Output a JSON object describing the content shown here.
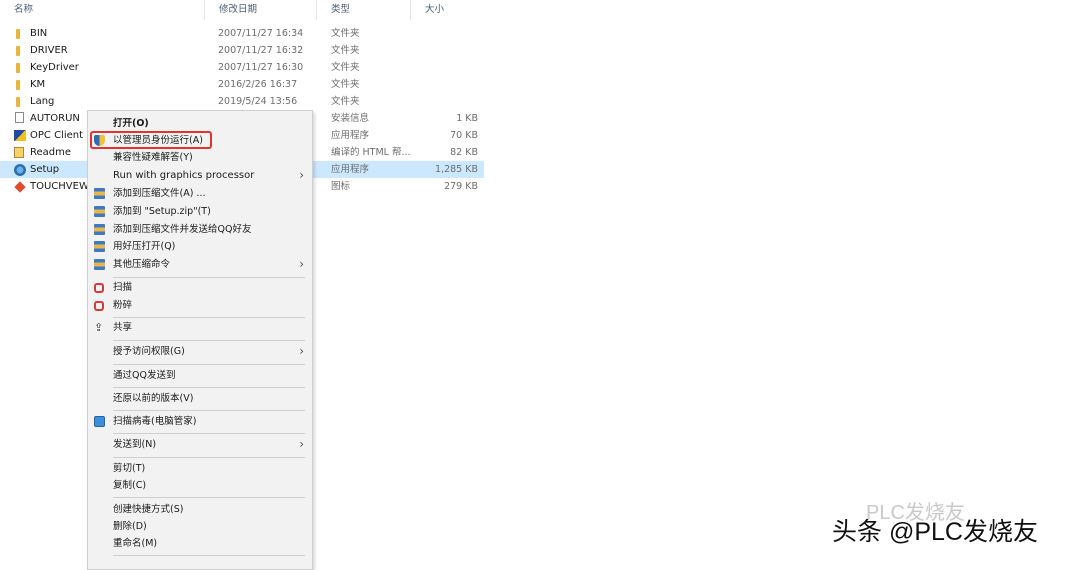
{
  "columns": {
    "name": "名称",
    "date": "修改日期",
    "type": "类型",
    "size": "大小"
  },
  "files": [
    {
      "icon": "folder-icon",
      "name": "BIN",
      "date": "2007/11/27 16:34",
      "type": "文件夹",
      "size": ""
    },
    {
      "icon": "folder-icon",
      "name": "DRIVER",
      "date": "2007/11/27 16:32",
      "type": "文件夹",
      "size": ""
    },
    {
      "icon": "folder-icon",
      "name": "KeyDriver",
      "date": "2007/11/27 16:30",
      "type": "文件夹",
      "size": ""
    },
    {
      "icon": "folder-icon",
      "name": "KM",
      "date": "2016/2/26 16:37",
      "type": "文件夹",
      "size": ""
    },
    {
      "icon": "folder-icon",
      "name": "Lang",
      "date": "2019/5/24 13:56",
      "type": "文件夹",
      "size": ""
    },
    {
      "icon": "inf-file-icon",
      "name": "AUTORUN",
      "date": "",
      "type": "安装信息",
      "size": "1 KB"
    },
    {
      "icon": "app-icon",
      "name": "OPC Client",
      "date": "",
      "type": "应用程序",
      "size": "70 KB"
    },
    {
      "icon": "help-file-icon",
      "name": "Readme",
      "date": "",
      "type": "编译的 HTML 帮...",
      "size": "82 KB"
    },
    {
      "icon": "setup-icon",
      "name": "Setup",
      "date": "",
      "type": "应用程序",
      "size": "1,285 KB"
    },
    {
      "icon": "touchview-icon",
      "name": "TOUCHVEW",
      "date": "",
      "type": "图标",
      "size": "279 KB"
    }
  ],
  "context_menu": {
    "open": "打开(O)",
    "run_as_admin": "以管理员身份运行(A)",
    "compat": "兼容性疑难解答(Y)",
    "gpu": "Run with graphics processor",
    "add_archive": "添加到压缩文件(A) ...",
    "add_zip": "添加到 \"Setup.zip\"(T)",
    "add_send_qq": "添加到压缩文件并发送给QQ好友",
    "open_haozip": "用好压打开(Q)",
    "other_zip": "其他压缩命令",
    "scan": "扫描",
    "shred": "粉碎",
    "share": "共享",
    "grant_access": "授予访问权限(G)",
    "send_qq": "通过QQ发送到",
    "restore": "还原以前的版本(V)",
    "virus_scan": "扫描病毒(电脑管家)",
    "send_to": "发送到(N)",
    "cut": "剪切(T)",
    "copy": "复制(C)",
    "create_shortcut": "创建快捷方式(S)",
    "delete": "删除(D)",
    "rename": "重命名(M)"
  },
  "watermark": {
    "faint": "PLC发烧友",
    "main": "头条 @PLC发烧友"
  },
  "colors": {
    "selection": "#cce8ff",
    "highlight_border": "#e0342e",
    "menu_bg": "#f2f2f2"
  }
}
